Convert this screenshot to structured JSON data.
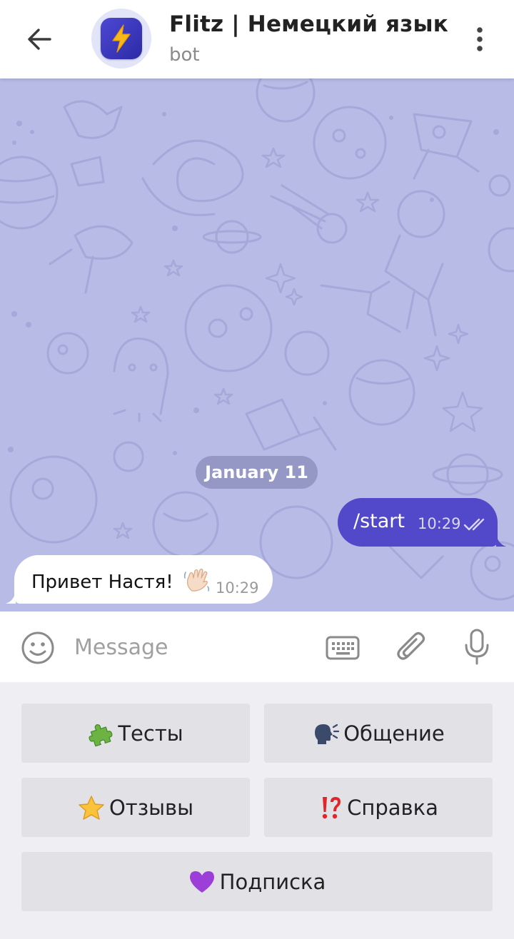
{
  "header": {
    "title": "Flitz | Немецкий язык",
    "subtitle": "bot"
  },
  "chat": {
    "date_label": "January 11",
    "messages": [
      {
        "direction": "outgoing",
        "text": "/start",
        "time": "10:29",
        "status": "read"
      },
      {
        "direction": "incoming",
        "text": "Привет Настя!",
        "emoji": "waving-hand",
        "time": "10:29"
      }
    ]
  },
  "input": {
    "placeholder": "Message"
  },
  "keyboard": {
    "buttons": [
      {
        "label": "Тесты",
        "icon": "puzzle-piece-icon"
      },
      {
        "label": "Общение",
        "icon": "speaking-head-icon"
      },
      {
        "label": "Отзывы",
        "icon": "star-icon"
      },
      {
        "label": "Справка",
        "icon": "exclamation-question-icon"
      },
      {
        "label": "Подписка",
        "icon": "purple-heart-icon"
      }
    ]
  },
  "colors": {
    "accent": "#5149c9",
    "chat_background": "#b8bbe6",
    "header_background": "#ffffff",
    "keyboard_background": "#efeff3",
    "keyboard_button": "#e1e1e6"
  }
}
